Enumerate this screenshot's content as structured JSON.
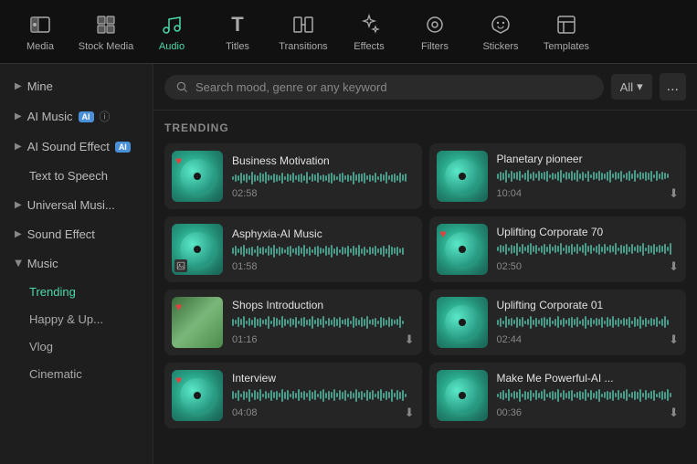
{
  "nav": {
    "items": [
      {
        "id": "media",
        "label": "Media",
        "icon": "🎬",
        "active": false
      },
      {
        "id": "stock-media",
        "label": "Stock Media",
        "icon": "📷",
        "active": false
      },
      {
        "id": "audio",
        "label": "Audio",
        "icon": "🎵",
        "active": true
      },
      {
        "id": "titles",
        "label": "Titles",
        "icon": "T",
        "active": false
      },
      {
        "id": "transitions",
        "label": "Transitions",
        "icon": "⬜",
        "active": false
      },
      {
        "id": "effects",
        "label": "Effects",
        "icon": "✦",
        "active": false
      },
      {
        "id": "filters",
        "label": "Filters",
        "icon": "⊙",
        "active": false
      },
      {
        "id": "stickers",
        "label": "Stickers",
        "icon": "😊",
        "active": false
      },
      {
        "id": "templates",
        "label": "Templates",
        "icon": "▣",
        "active": false
      }
    ]
  },
  "sidebar": {
    "items": [
      {
        "id": "mine",
        "label": "Mine",
        "type": "expandable",
        "indent": false
      },
      {
        "id": "ai-music",
        "label": "AI Music",
        "type": "expandable",
        "hasBadge": true,
        "hasInfo": true,
        "indent": false
      },
      {
        "id": "ai-sound-effect",
        "label": "AI Sound Effect",
        "type": "expandable",
        "hasBadge": true,
        "indent": false
      },
      {
        "id": "text-to-speech",
        "label": "Text to Speech",
        "type": "flat",
        "indent": false
      },
      {
        "id": "universal-music",
        "label": "Universal Musi...",
        "type": "expandable",
        "indent": false
      },
      {
        "id": "sound-effect",
        "label": "Sound Effect",
        "type": "expandable",
        "indent": false
      },
      {
        "id": "music",
        "label": "Music",
        "type": "expanded",
        "indent": false
      }
    ],
    "subItems": [
      {
        "id": "trending",
        "label": "Trending",
        "active": true
      },
      {
        "id": "happy-up",
        "label": "Happy & Up..."
      },
      {
        "id": "vlog",
        "label": "Vlog"
      },
      {
        "id": "cinematic",
        "label": "Cinematic"
      }
    ]
  },
  "search": {
    "placeholder": "Search mood, genre or any keyword",
    "filterLabel": "All",
    "moreLabel": "..."
  },
  "trending": {
    "sectionTitle": "TRENDING",
    "tracks": [
      {
        "id": "business-motivation",
        "title": "Business Motivation",
        "duration": "02:58",
        "hasHeart": true,
        "hasDownload": false,
        "thumbType": "teal"
      },
      {
        "id": "planetary-pioneer",
        "title": "Planetary pioneer",
        "duration": "10:04",
        "hasHeart": false,
        "hasDownload": true,
        "thumbType": "teal"
      },
      {
        "id": "asphyxia-ai",
        "title": "Asphyxia-AI Music",
        "duration": "01:58",
        "hasHeart": false,
        "hasDownload": false,
        "thumbType": "teal",
        "hasImageBadge": true
      },
      {
        "id": "uplifting-corporate-70",
        "title": "Uplifting Corporate 70",
        "duration": "02:50",
        "hasHeart": true,
        "hasDownload": true,
        "thumbType": "teal"
      },
      {
        "id": "shops-introduction",
        "title": "Shops Introduction",
        "duration": "01:16",
        "hasHeart": true,
        "hasDownload": true,
        "thumbType": "landscape"
      },
      {
        "id": "uplifting-corporate-01",
        "title": "Uplifting Corporate 01",
        "duration": "02:44",
        "hasHeart": false,
        "hasDownload": true,
        "thumbType": "teal"
      },
      {
        "id": "interview",
        "title": "Interview",
        "duration": "04:08",
        "hasHeart": true,
        "hasDownload": true,
        "thumbType": "teal"
      },
      {
        "id": "make-me-powerful",
        "title": "Make Me Powerful-AI ...",
        "duration": "00:36",
        "hasHeart": false,
        "hasDownload": true,
        "thumbType": "teal"
      }
    ]
  }
}
